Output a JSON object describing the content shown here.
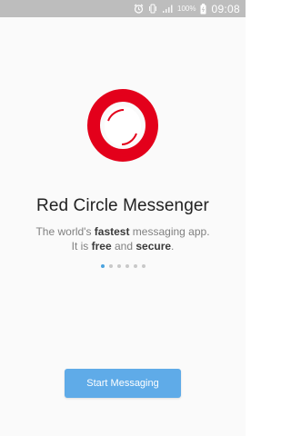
{
  "status_bar": {
    "icons": [
      "alarm-icon",
      "vibrate-icon",
      "signal-icon",
      "battery-icon"
    ],
    "battery": "100%",
    "time": "09:08"
  },
  "intro": {
    "title": "Red Circle Messenger",
    "tagline_line1_a": "The world's ",
    "tagline_line1_b": "fastest",
    "tagline_line1_c": " messaging app.",
    "tagline_line2_a": "It is ",
    "tagline_line2_b": "free",
    "tagline_line2_c": " and ",
    "tagline_line2_d": "secure",
    "tagline_line2_e": ".",
    "pages_total": 6,
    "page_active": 1
  },
  "actions": {
    "start_label": "Start Messaging"
  },
  "colors": {
    "logo": "#e3001b",
    "button": "#5fabe8",
    "active_dot": "#4aa3df"
  }
}
